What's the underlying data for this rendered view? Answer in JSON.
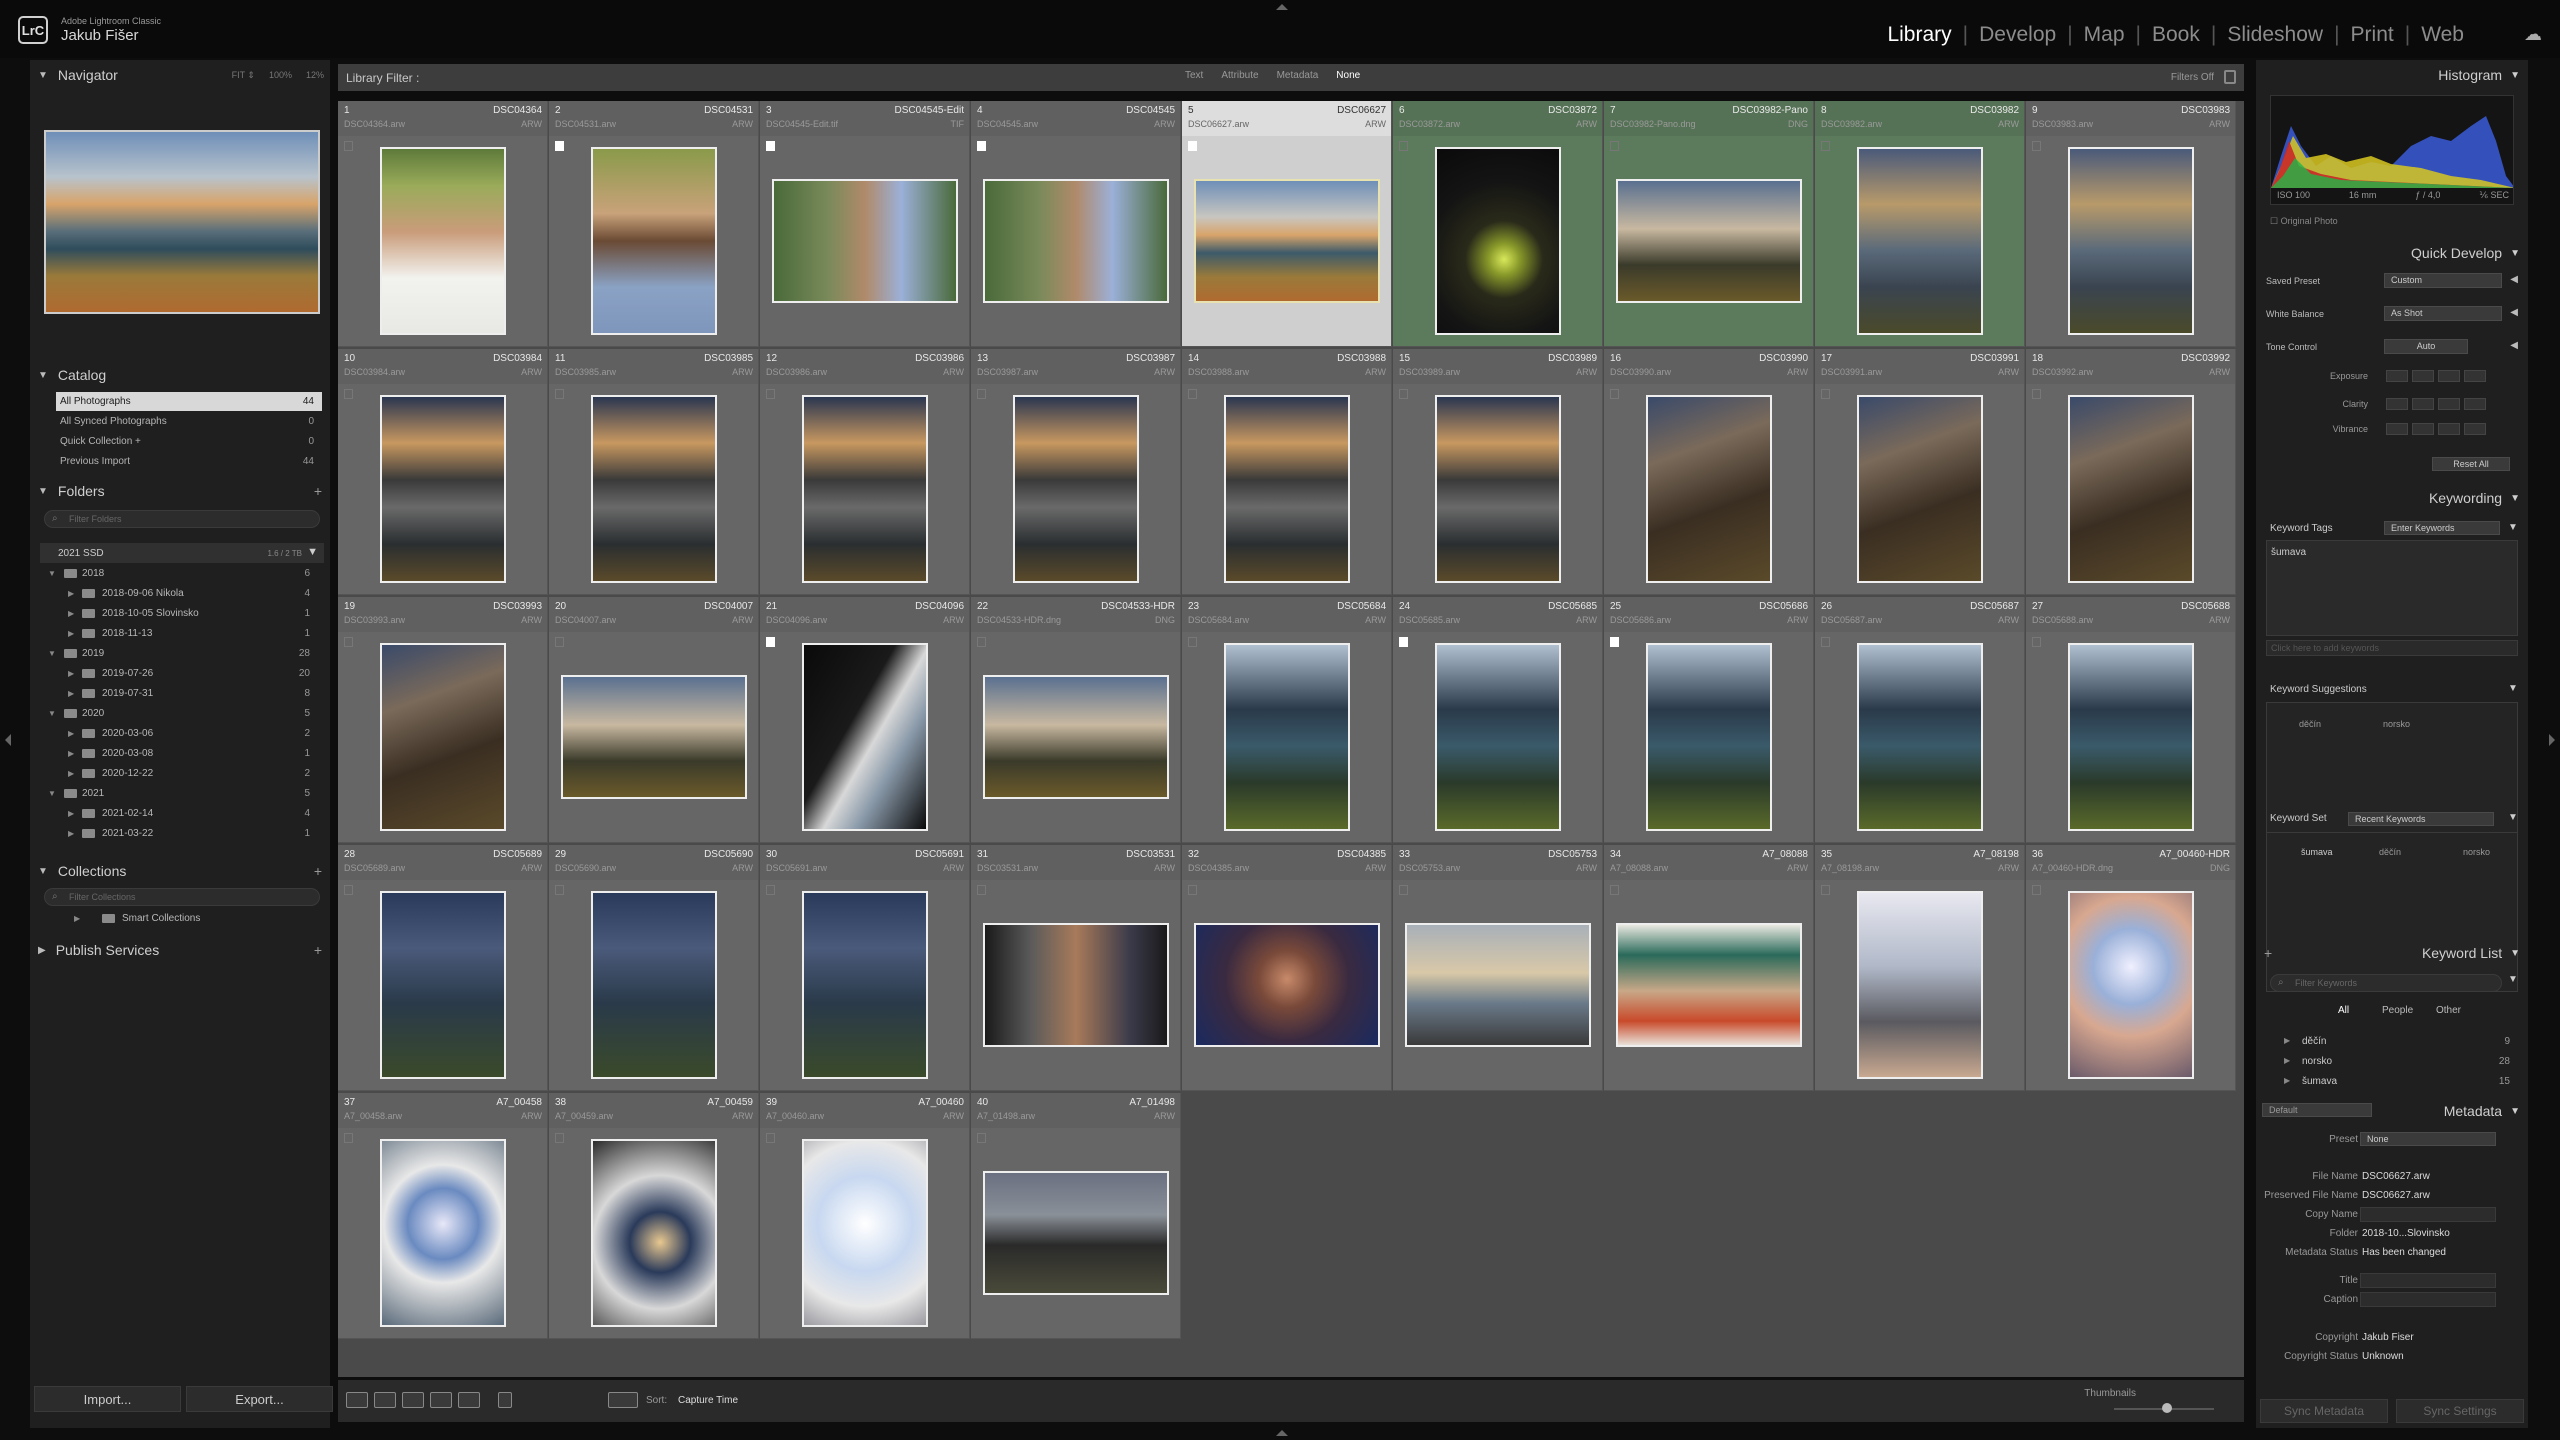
{
  "app": {
    "product": "Adobe Lightroom Classic",
    "user": "Jakub Fišer",
    "logo": "LrC"
  },
  "modules": [
    {
      "label": "Library",
      "active": true
    },
    {
      "label": "Develop"
    },
    {
      "label": "Map"
    },
    {
      "label": "Book"
    },
    {
      "label": "Slideshow"
    },
    {
      "label": "Print"
    },
    {
      "label": "Web"
    }
  ],
  "navigator": {
    "title": "Navigator",
    "zoom_fit": "FIT ⇕",
    "zoom_100": "100%",
    "zoom_12": "12%"
  },
  "catalog": {
    "title": "Catalog",
    "items": [
      {
        "label": "All Photographs",
        "count": "44"
      },
      {
        "label": "All Synced Photographs",
        "count": "0"
      },
      {
        "label": "Quick Collection +",
        "count": "0"
      },
      {
        "label": "Previous Import",
        "count": "44"
      }
    ]
  },
  "folders": {
    "title": "Folders",
    "plus": "+",
    "search_placeholder": "Filter Folders",
    "volume": {
      "name": "2021 SSD",
      "size": "1.6 / 2 TB"
    },
    "items": [
      {
        "label": "2018",
        "count": "6"
      },
      {
        "label": "2018-09-06 Nikola",
        "count": "4"
      },
      {
        "label": "2018-10-05 Slovinsko",
        "count": "1"
      },
      {
        "label": "2018-11-13",
        "count": "1"
      },
      {
        "label": "2019",
        "count": "28"
      },
      {
        "label": "2019-07-26",
        "count": "20"
      },
      {
        "label": "2019-07-31",
        "count": "8"
      },
      {
        "label": "2020",
        "count": "5"
      },
      {
        "label": "2020-03-06",
        "count": "2"
      },
      {
        "label": "2020-03-08",
        "count": "1"
      },
      {
        "label": "2020-12-22",
        "count": "2"
      },
      {
        "label": "2021",
        "count": "5"
      },
      {
        "label": "2021-02-14",
        "count": "4"
      },
      {
        "label": "2021-03-22",
        "count": "1"
      }
    ]
  },
  "collections": {
    "title": "Collections",
    "plus": "+",
    "search_placeholder": "Filter Collections",
    "smart": "Smart Collections"
  },
  "publish": {
    "title": "Publish Services",
    "plus": "+"
  },
  "buttons": {
    "import": "Import...",
    "export": "Export..."
  },
  "filterbar": {
    "label": "Library Filter :",
    "options": [
      {
        "label": "Text"
      },
      {
        "label": "Attribute"
      },
      {
        "label": "Metadata"
      },
      {
        "label": "None",
        "active": true
      }
    ],
    "status": "Filters Off"
  },
  "photos": [
    {
      "num": "1",
      "name": "DSC04364",
      "file": "DSC04364.arw",
      "ext": "ARW",
      "fill": "g-girl1",
      "orient": "portrait"
    },
    {
      "num": "2",
      "name": "DSC04531",
      "file": "DSC04531.arw",
      "ext": "ARW",
      "fill": "g-girl2",
      "orient": "portrait",
      "flag": true
    },
    {
      "num": "3",
      "name": "DSC04545-Edit",
      "file": "DSC04545-Edit.tif",
      "ext": "TIF",
      "fill": "g-girl3",
      "orient": "land",
      "flag": true
    },
    {
      "num": "4",
      "name": "DSC04545",
      "file": "DSC04545.arw",
      "ext": "ARW",
      "fill": "g-girl3",
      "orient": "land",
      "flag": true
    },
    {
      "num": "5",
      "name": "DSC06627",
      "file": "DSC06627.arw",
      "ext": "ARW",
      "fill": "g-lake",
      "orient": "land",
      "flag": true,
      "sel": true
    },
    {
      "num": "6",
      "name": "DSC03872",
      "file": "DSC03872.arw",
      "ext": "ARW",
      "fill": "g-drink",
      "orient": "portrait",
      "green": true
    },
    {
      "num": "7",
      "name": "DSC03982-Pano",
      "file": "DSC03982-Pano.dng",
      "ext": "DNG",
      "fill": "g-fogland",
      "orient": "land",
      "green": true
    },
    {
      "num": "8",
      "name": "DSC03982",
      "file": "DSC03982.arw",
      "ext": "ARW",
      "fill": "g-fog",
      "orient": "portrait",
      "green": true
    },
    {
      "num": "9",
      "name": "DSC03983",
      "file": "DSC03983.arw",
      "ext": "ARW",
      "fill": "g-fog",
      "orient": "portrait"
    },
    {
      "num": "10",
      "name": "DSC03984",
      "file": "DSC03984.arw",
      "ext": "ARW",
      "fill": "g-mtn",
      "orient": "portrait"
    },
    {
      "num": "11",
      "name": "DSC03985",
      "file": "DSC03985.arw",
      "ext": "ARW",
      "fill": "g-mtn",
      "orient": "portrait"
    },
    {
      "num": "12",
      "name": "DSC03986",
      "file": "DSC03986.arw",
      "ext": "ARW",
      "fill": "g-mtn",
      "orient": "portrait"
    },
    {
      "num": "13",
      "name": "DSC03987",
      "file": "DSC03987.arw",
      "ext": "ARW",
      "fill": "g-mtn",
      "orient": "portrait"
    },
    {
      "num": "14",
      "name": "DSC03988",
      "file": "DSC03988.arw",
      "ext": "ARW",
      "fill": "g-mtn",
      "orient": "portrait"
    },
    {
      "num": "15",
      "name": "DSC03989",
      "file": "DSC03989.arw",
      "ext": "ARW",
      "fill": "g-mtn",
      "orient": "portrait"
    },
    {
      "num": "16",
      "name": "DSC03990",
      "file": "DSC03990.arw",
      "ext": "ARW",
      "fill": "g-rock",
      "orient": "portrait"
    },
    {
      "num": "17",
      "name": "DSC03991",
      "file": "DSC03991.arw",
      "ext": "ARW",
      "fill": "g-rock",
      "orient": "portrait"
    },
    {
      "num": "18",
      "name": "DSC03992",
      "file": "DSC03992.arw",
      "ext": "ARW",
      "fill": "g-rock",
      "orient": "portrait"
    },
    {
      "num": "19",
      "name": "DSC03993",
      "file": "DSC03993.arw",
      "ext": "ARW",
      "fill": "g-rock",
      "orient": "portrait"
    },
    {
      "num": "20",
      "name": "DSC04007",
      "file": "DSC04007.arw",
      "ext": "ARW",
      "fill": "g-fogland",
      "orient": "land"
    },
    {
      "num": "21",
      "name": "DSC04096",
      "file": "DSC04096.arw",
      "ext": "ARW",
      "fill": "g-arch",
      "orient": "portrait",
      "flag": true
    },
    {
      "num": "22",
      "name": "DSC04533-HDR",
      "file": "DSC04533-HDR.dng",
      "ext": "DNG",
      "fill": "g-fogland",
      "orient": "land"
    },
    {
      "num": "23",
      "name": "DSC05684",
      "file": "DSC05684.arw",
      "ext": "ARW",
      "fill": "g-valley",
      "orient": "portrait"
    },
    {
      "num": "24",
      "name": "DSC05685",
      "file": "DSC05685.arw",
      "ext": "ARW",
      "fill": "g-valley",
      "orient": "portrait",
      "flag": true
    },
    {
      "num": "25",
      "name": "DSC05686",
      "file": "DSC05686.arw",
      "ext": "ARW",
      "fill": "g-valley",
      "orient": "portrait",
      "flag": true
    },
    {
      "num": "26",
      "name": "DSC05687",
      "file": "DSC05687.arw",
      "ext": "ARW",
      "fill": "g-valley",
      "orient": "portrait"
    },
    {
      "num": "27",
      "name": "DSC05688",
      "file": "DSC05688.arw",
      "ext": "ARW",
      "fill": "g-valley",
      "orient": "portrait"
    },
    {
      "num": "28",
      "name": "DSC05689",
      "file": "DSC05689.arw",
      "ext": "ARW",
      "fill": "g-night",
      "orient": "portrait"
    },
    {
      "num": "29",
      "name": "DSC05690",
      "file": "DSC05690.arw",
      "ext": "ARW",
      "fill": "g-night",
      "orient": "portrait"
    },
    {
      "num": "30",
      "name": "DSC05691",
      "file": "DSC05691.arw",
      "ext": "ARW",
      "fill": "g-night",
      "orient": "portrait"
    },
    {
      "num": "31",
      "name": "DSC03531",
      "file": "DSC03531.arw",
      "ext": "ARW",
      "fill": "g-fighter1",
      "orient": "land"
    },
    {
      "num": "32",
      "name": "DSC04385",
      "file": "DSC04385.arw",
      "ext": "ARW",
      "fill": "g-fighter2",
      "orient": "land"
    },
    {
      "num": "33",
      "name": "DSC05753",
      "file": "DSC05753.arw",
      "ext": "ARW",
      "fill": "g-hiker",
      "orient": "land"
    },
    {
      "num": "34",
      "name": "A7_08088",
      "file": "A7_08088.arw",
      "ext": "ARW",
      "fill": "g-hotel",
      "orient": "land"
    },
    {
      "num": "35",
      "name": "A7_08198",
      "file": "A7_08198.arw",
      "ext": "ARW",
      "fill": "g-bird",
      "orient": "portrait"
    },
    {
      "num": "36",
      "name": "A7_00460-HDR",
      "file": "A7_00460-HDR.dng",
      "ext": "DNG",
      "fill": "g-frost",
      "orient": "portrait"
    },
    {
      "num": "37",
      "name": "A7_00458",
      "file": "A7_00458.arw",
      "ext": "ARW",
      "fill": "g-frost2",
      "orient": "portrait"
    },
    {
      "num": "38",
      "name": "A7_00459",
      "file": "A7_00459.arw",
      "ext": "ARW",
      "fill": "g-frostdark",
      "orient": "portrait"
    },
    {
      "num": "39",
      "name": "A7_00460",
      "file": "A7_00460.arw",
      "ext": "ARW",
      "fill": "g-frostwhite",
      "orient": "portrait"
    },
    {
      "num": "40",
      "name": "A7_01498",
      "file": "A7_01498.arw",
      "ext": "ARW",
      "fill": "g-car",
      "orient": "land"
    }
  ],
  "toolbar": {
    "sort_label": "Sort:",
    "sort_value": "Capture Time",
    "thumbnails_label": "Thumbnails"
  },
  "histogram": {
    "title": "Histogram",
    "iso": "ISO 100",
    "focal": "16 mm",
    "aperture": "ƒ / 4,0",
    "shutter": "⅙ SEC",
    "original": "Original Photo"
  },
  "quick_develop": {
    "title": "Quick Develop",
    "saved_preset_label": "Saved Preset",
    "saved_preset_value": "Custom",
    "white_balance_label": "White Balance",
    "white_balance_value": "As Shot",
    "tone_control_label": "Tone Control",
    "tone_control_value": "Auto",
    "exposure": "Exposure",
    "clarity": "Clarity",
    "vibrance": "Vibrance",
    "reset": "Reset All"
  },
  "keywording": {
    "title": "Keywording",
    "tags_label": "Keyword Tags",
    "tags_value": "Enter Keywords",
    "current": "šumava",
    "add_placeholder": "Click here to add keywords",
    "suggestions_label": "Keyword Suggestions",
    "suggestions": [
      "děčín",
      "norsko"
    ],
    "set_label": "Keyword Set",
    "set_value": "Recent Keywords",
    "set_items": [
      "šumava",
      "děčín",
      "norsko"
    ]
  },
  "keyword_list": {
    "title": "Keyword List",
    "plus": "+",
    "search_placeholder": "Filter Keywords",
    "tabs": [
      {
        "label": "All",
        "active": true
      },
      {
        "label": "People"
      },
      {
        "label": "Other"
      }
    ],
    "items": [
      {
        "label": "děčín",
        "count": "9"
      },
      {
        "label": "norsko",
        "count": "28"
      },
      {
        "label": "šumava",
        "count": "15"
      }
    ]
  },
  "metadata": {
    "title": "Metadata",
    "view_preset": "Default",
    "preset_label": "Preset",
    "preset_value": "None",
    "rows": [
      {
        "label": "File Name",
        "value": "DSC06627.arw"
      },
      {
        "label": "Preserved File Name",
        "value": "DSC06627.arw"
      },
      {
        "label": "Copy Name",
        "value": ""
      },
      {
        "label": "Folder",
        "value": "2018-10...Slovinsko"
      },
      {
        "label": "Metadata Status",
        "value": "Has been changed"
      },
      {
        "label": "Title",
        "value": ""
      },
      {
        "label": "Caption",
        "value": ""
      },
      {
        "label": "Copyright",
        "value": "Jakub Fiser"
      },
      {
        "label": "Copyright Status",
        "value": "Unknown"
      }
    ]
  },
  "sync": {
    "metadata": "Sync Metadata",
    "settings": "Sync Settings"
  }
}
